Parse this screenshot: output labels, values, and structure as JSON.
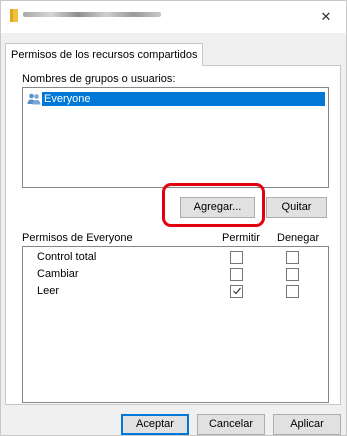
{
  "window": {
    "close_glyph": "✕"
  },
  "tabs": [
    {
      "label": "Permisos de los recursos compartidos"
    }
  ],
  "groups_section": {
    "label": "Nombres de grupos o usuarios:",
    "items": [
      {
        "label": "Everyone",
        "icon": "users-icon",
        "selected": true
      }
    ]
  },
  "buttons": {
    "add": "Agregar...",
    "remove": "Quitar",
    "ok": "Aceptar",
    "cancel": "Cancelar",
    "apply": "Aplicar"
  },
  "permissions": {
    "label": "Permisos de Everyone",
    "allow_header": "Permitir",
    "deny_header": "Denegar",
    "rows": [
      {
        "label": "Control total",
        "allow": false,
        "deny": false
      },
      {
        "label": "Cambiar",
        "allow": false,
        "deny": false
      },
      {
        "label": "Leer",
        "allow": true,
        "deny": false
      }
    ]
  },
  "colors": {
    "selection": "#0078d7",
    "highlight_ring": "#e3000f",
    "folder": "#f0c040"
  }
}
